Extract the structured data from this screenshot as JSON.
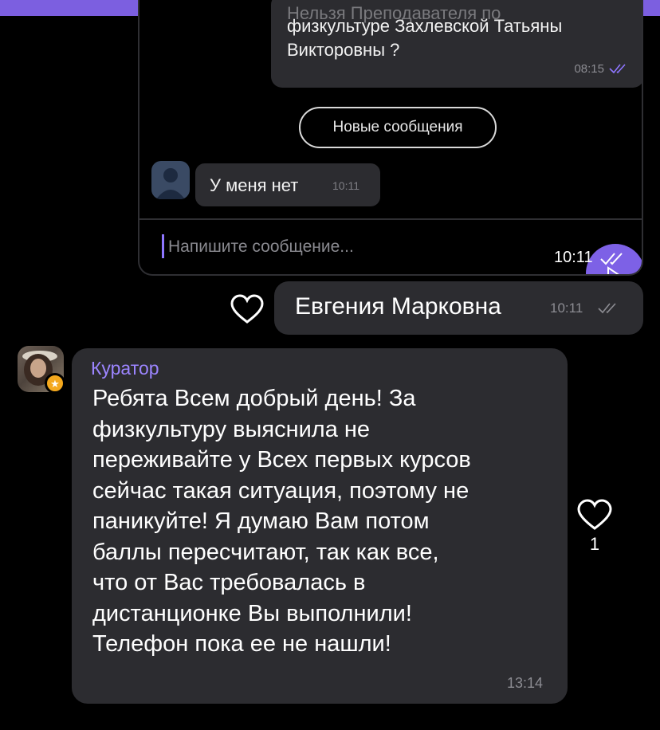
{
  "embedded_chat": {
    "cut_text": "Нельзя Преподавателя по",
    "message_line1": "физкультуре Захлевской Татьяны",
    "message_line2": "Викторовны ?",
    "message_time": "08:15",
    "new_messages_label": "Новые сообщения",
    "reply_text": "У меня нет",
    "reply_time": "10:11",
    "input_placeholder": "Напишите сообщение..."
  },
  "forwarded_timestamp": "10:11",
  "messages": [
    {
      "text": "Евгения Марковна",
      "time": "10:11",
      "outgoing": true
    },
    {
      "sender": "Куратор",
      "text": "Ребята Всем добрый день! За\nфизкультуру выяснила не\nпереживайте у Всех первых курсов\nсейчас такая ситуация, поэтому не\nпаникуйте! Я думаю Вам потом\nбаллы пересчитают, так как все,\nчто от Вас требовалась в\nдистанционке Вы выполнили!\nТелефон пока ее не нашли!",
      "time": "13:14",
      "likes": "1"
    }
  ],
  "colors": {
    "accent": "#7c5fe0",
    "bubble": "#2c2c30",
    "sender_name": "#9c85ff",
    "badge": "#f4a81d"
  }
}
